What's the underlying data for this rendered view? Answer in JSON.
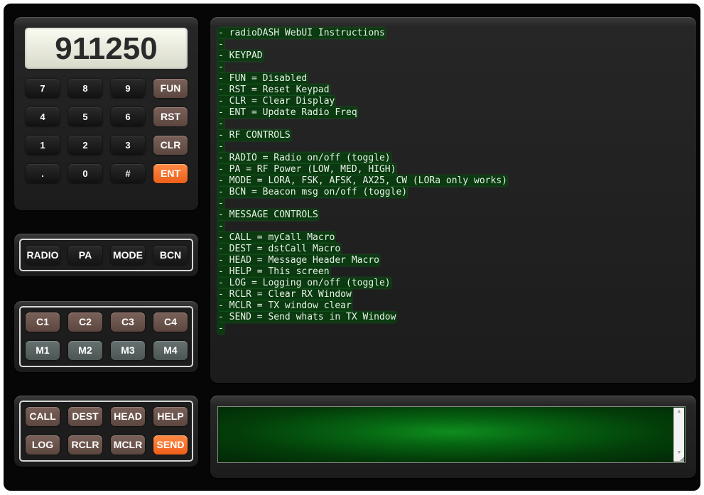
{
  "keypad": {
    "display_value": "911250",
    "rows": [
      [
        "7",
        "8",
        "9",
        "FUN"
      ],
      [
        "4",
        "5",
        "6",
        "RST"
      ],
      [
        "1",
        "2",
        "3",
        "CLR"
      ],
      [
        ".",
        "0",
        "#",
        "ENT"
      ]
    ]
  },
  "rf_controls": [
    "RADIO",
    "PA",
    "MODE",
    "BCN"
  ],
  "macro_controls": {
    "channels": [
      "C1",
      "C2",
      "C3",
      "C4"
    ],
    "memories": [
      "M1",
      "M2",
      "M3",
      "M4"
    ]
  },
  "message_controls": {
    "row1": [
      "CALL",
      "DEST",
      "HEAD",
      "HELP"
    ],
    "row2": [
      "LOG",
      "RCLR",
      "MCLR",
      "SEND"
    ]
  },
  "instructions": [
    "- radioDASH WebUI Instructions",
    "-",
    "- KEYPAD",
    "-",
    "- FUN = Disabled",
    "- RST = Reset Keypad",
    "- CLR = Clear Display",
    "- ENT = Update Radio Freq",
    "-",
    "- RF CONTROLS",
    "-",
    "- RADIO = Radio on/off (toggle)",
    "- PA = RF Power (LOW, MED, HIGH)",
    "- MODE = LORA, FSK, AFSK, AX25, CW (LORa only works)",
    "- BCN = Beacon msg on/off (toggle)",
    "-",
    "- MESSAGE CONTROLS",
    "-",
    "- CALL = myCall Macro",
    "- DEST = dstCall Macro",
    "- HEAD = Message Header Macro",
    "- HELP = This screen",
    "- LOG = Logging on/off (toggle)",
    "- RCLR = Clear RX Window",
    "- MCLR = TX window clear",
    "- SEND = Send whats in TX Window",
    "-"
  ],
  "tx_window": {
    "value": ""
  },
  "colors": {
    "orange_button": "#f26b21",
    "brown_button": "#6b524a",
    "slate_button": "#58625f",
    "terminal_highlight": "#0b3a10",
    "tx_green": "#0a7a18"
  }
}
